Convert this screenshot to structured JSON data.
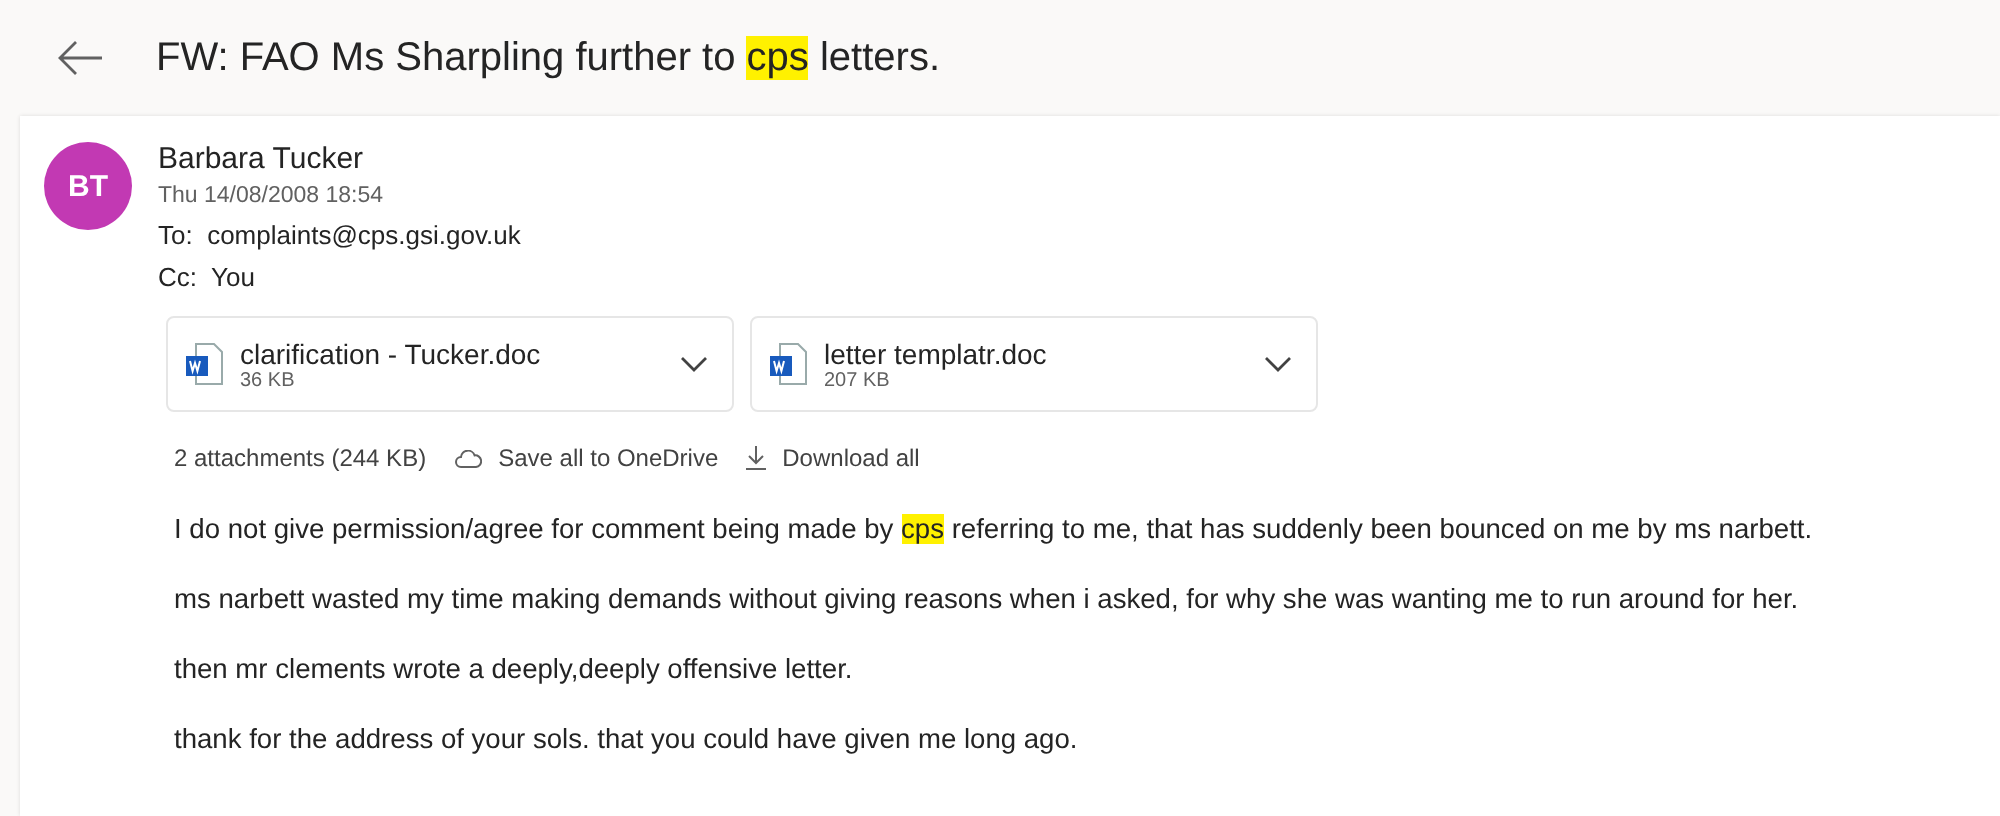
{
  "subject": [
    {
      "text": "FW: FAO Ms Sharpling further to ",
      "highlighted": false
    },
    {
      "text": "cps",
      "highlighted": true
    },
    {
      "text": " letters.",
      "highlighted": false
    }
  ],
  "sender": {
    "initials": "BT",
    "name": "Barbara Tucker",
    "date": "Thu 14/08/2008 18:54",
    "to_label": "To:",
    "to": "complaints@cps.gsi.gov.uk",
    "cc_label": "Cc:",
    "cc": "You"
  },
  "attachments": [
    {
      "name": "clarification - Tucker.doc",
      "size": "36 KB"
    },
    {
      "name": "letter templatr.doc",
      "size": "207 KB"
    }
  ],
  "attachment_summary": "2 attachments (244 KB)",
  "actions": [
    "Save all to OneDrive",
    "Download all"
  ],
  "body": [
    [
      {
        "text": "I do not give permission/agree for comment being made by ",
        "highlighted": false
      },
      {
        "text": "cps",
        "highlighted": true
      },
      {
        "text": " referring to me, that has suddenly been bounced on me by ms narbett.",
        "highlighted": false
      }
    ],
    [
      {
        "text": "ms narbett wasted my time making demands without giving reasons when i asked, for why she was wanting me to run around for her.",
        "highlighted": false
      }
    ],
    [
      {
        "text": "then mr clements wrote a deeply,deeply offensive letter.",
        "highlighted": false
      }
    ],
    [
      {
        "text": "thank for the address of your sols. that you could have given me long ago.",
        "highlighted": false
      }
    ]
  ]
}
